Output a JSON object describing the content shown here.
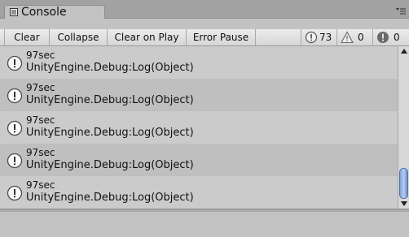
{
  "window": {
    "tab_title": "Console",
    "tab_icon": "console-icon",
    "menu_icon": "window-menu-icon"
  },
  "toolbar": {
    "buttons": [
      {
        "label": "Clear"
      },
      {
        "label": "Collapse"
      },
      {
        "label": "Clear on Play"
      },
      {
        "label": "Error Pause"
      }
    ],
    "counters": {
      "info": {
        "icon": "info-icon",
        "count": "73"
      },
      "warning": {
        "icon": "warning-icon",
        "count": "0"
      },
      "error": {
        "icon": "error-icon",
        "count": "0"
      }
    }
  },
  "log": {
    "entries": [
      {
        "icon": "info-icon",
        "message": "97sec",
        "source": "UnityEngine.Debug:Log(Object)"
      },
      {
        "icon": "info-icon",
        "message": "97sec",
        "source": "UnityEngine.Debug:Log(Object)"
      },
      {
        "icon": "info-icon",
        "message": "97sec",
        "source": "UnityEngine.Debug:Log(Object)"
      },
      {
        "icon": "info-icon",
        "message": "97sec",
        "source": "UnityEngine.Debug:Log(Object)"
      },
      {
        "icon": "info-icon",
        "message": "97sec",
        "source": "UnityEngine.Debug:Log(Object)"
      }
    ]
  },
  "colors": {
    "background": "#c2c2c2",
    "scroll_thumb": "#7ea0d8"
  }
}
